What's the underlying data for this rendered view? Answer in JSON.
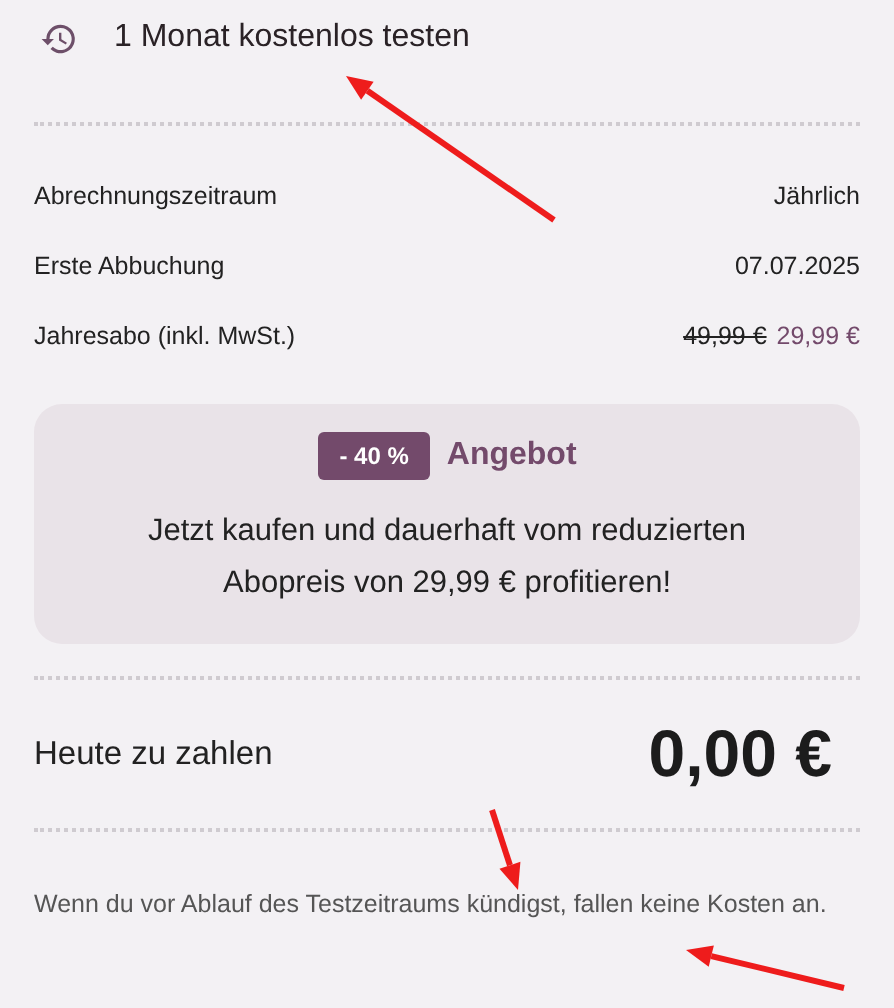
{
  "header": {
    "title": "1 Monat kostenlos testen"
  },
  "details": [
    {
      "label": "Abrechnungszeitraum",
      "value": "Jährlich"
    },
    {
      "label": "Erste Abbuchung",
      "value": "07.07.2025"
    },
    {
      "label": "Jahresabo (inkl. MwSt.)",
      "old_price": "49,99 €",
      "value": "29,99 €"
    }
  ],
  "offer": {
    "badge": "- 40 %",
    "title": "Angebot",
    "text": "Jetzt kaufen und dauerhaft vom reduzierten Abopreis von 29,99 € profitieren!"
  },
  "total": {
    "label": "Heute zu zahlen",
    "amount": "0,00 €"
  },
  "note": "Wenn du vor Ablauf des Testzeitraums kündigst, fallen keine Kosten an."
}
